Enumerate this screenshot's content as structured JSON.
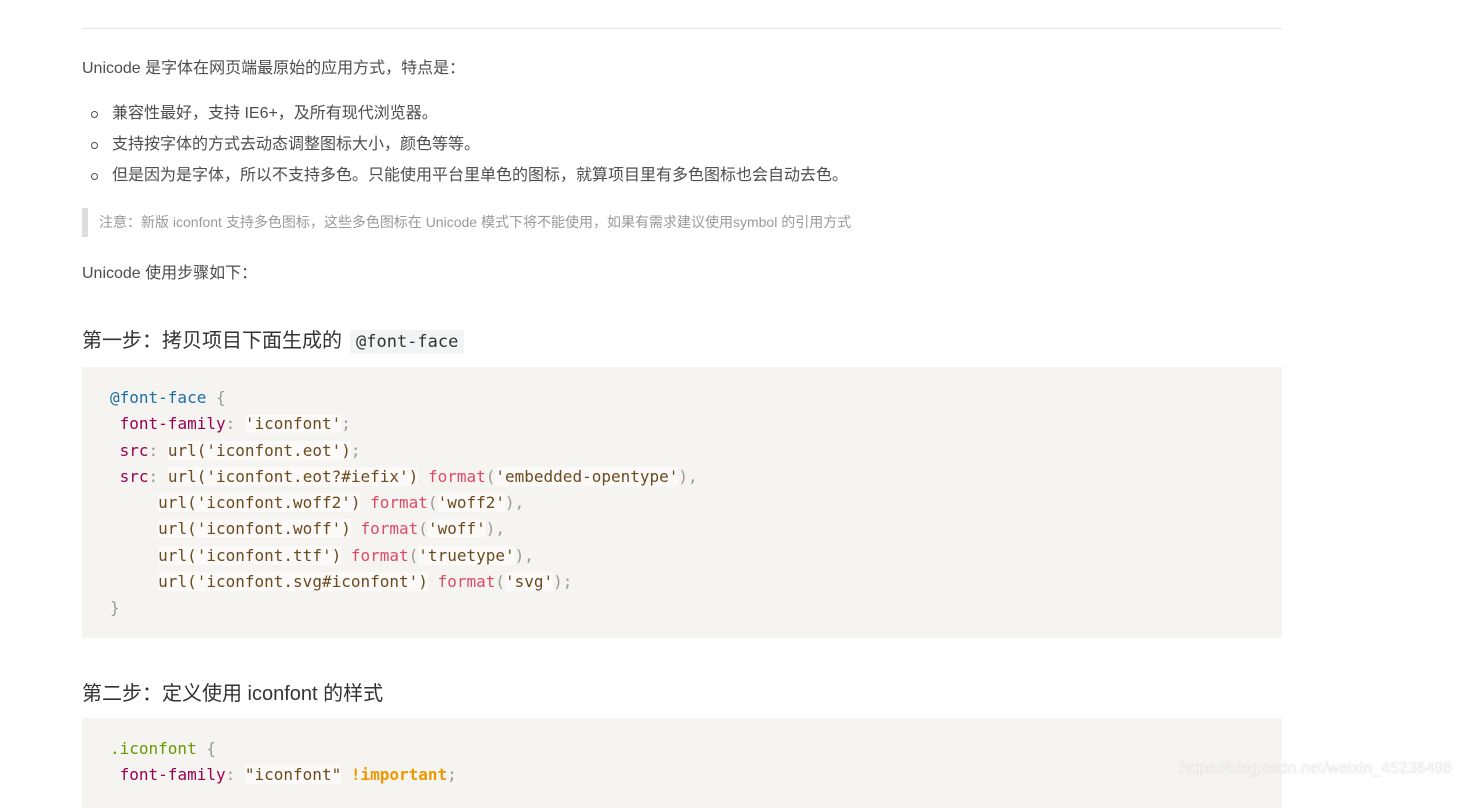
{
  "intro": "Unicode 是字体在网页端最原始的应用方式，特点是：",
  "bullets": [
    "兼容性最好，支持 IE6+，及所有现代浏览器。",
    "支持按字体的方式去动态调整图标大小，颜色等等。",
    "但是因为是字体，所以不支持多色。只能使用平台里单色的图标，就算项目里有多色图标也会自动去色。"
  ],
  "note": "注意：新版 iconfont 支持多色图标，这些多色图标在 Unicode 模式下将不能使用，如果有需求建议使用symbol 的引用方式",
  "steps_intro": "Unicode 使用步骤如下：",
  "step1": {
    "title": "第一步：拷贝项目下面生成的",
    "inline_code": "@font-face",
    "code": {
      "at_rule": "@font-face",
      "open": " {",
      "prop_font_family": "font-family",
      "val_font_family": "'iconfont'",
      "prop_src": "src",
      "url_fn": "url",
      "format_fn": "format",
      "eot": "'iconfont.eot'",
      "eot_iefix": "'iconfont.eot?#iefix'",
      "embedded": "'embedded-opentype'",
      "woff2": "'iconfont.woff2'",
      "woff2_fmt": "'woff2'",
      "woff": "'iconfont.woff'",
      "woff_fmt": "'woff'",
      "ttf": "'iconfont.ttf'",
      "ttf_fmt": "'truetype'",
      "svg": "'iconfont.svg#iconfont'",
      "svg_fmt": "'svg'",
      "close": "}"
    }
  },
  "step2": {
    "title": "第二步：定义使用 iconfont 的样式",
    "code": {
      "selector": ".iconfont",
      "open": " {",
      "prop_font_family": "font-family",
      "val_font_family": "\"iconfont\"",
      "important": "!important"
    }
  },
  "watermark": "https://blog.csdn.net/weixin_45236498"
}
